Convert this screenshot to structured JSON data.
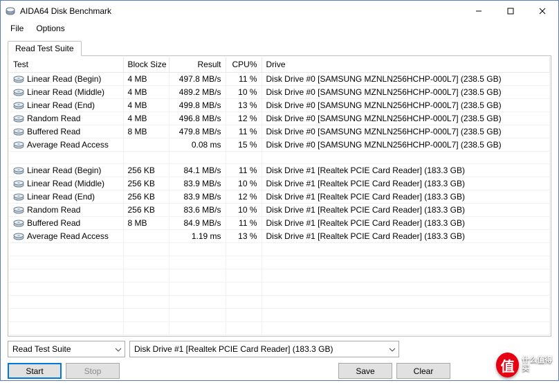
{
  "window": {
    "title": "AIDA64 Disk Benchmark"
  },
  "menu": {
    "file": "File",
    "options": "Options"
  },
  "tab": {
    "read_test_suite": "Read Test Suite"
  },
  "headers": {
    "test": "Test",
    "block_size": "Block Size",
    "result": "Result",
    "cpu": "CPU%",
    "drive": "Drive"
  },
  "rows": [
    {
      "test": "Linear Read (Begin)",
      "bs": "4 MB",
      "res": "497.8 MB/s",
      "cpu": "11 %",
      "drive": "Disk Drive #0  [SAMSUNG MZNLN256HCHP-000L7]  (238.5 GB)"
    },
    {
      "test": "Linear Read (Middle)",
      "bs": "4 MB",
      "res": "489.2 MB/s",
      "cpu": "10 %",
      "drive": "Disk Drive #0  [SAMSUNG MZNLN256HCHP-000L7]  (238.5 GB)"
    },
    {
      "test": "Linear Read (End)",
      "bs": "4 MB",
      "res": "499.8 MB/s",
      "cpu": "13 %",
      "drive": "Disk Drive #0  [SAMSUNG MZNLN256HCHP-000L7]  (238.5 GB)"
    },
    {
      "test": "Random Read",
      "bs": "4 MB",
      "res": "496.8 MB/s",
      "cpu": "12 %",
      "drive": "Disk Drive #0  [SAMSUNG MZNLN256HCHP-000L7]  (238.5 GB)"
    },
    {
      "test": "Buffered Read",
      "bs": "8 MB",
      "res": "479.8 MB/s",
      "cpu": "11 %",
      "drive": "Disk Drive #0  [SAMSUNG MZNLN256HCHP-000L7]  (238.5 GB)"
    },
    {
      "test": "Average Read Access",
      "bs": "",
      "res": "0.08 ms",
      "cpu": "15 %",
      "drive": "Disk Drive #0  [SAMSUNG MZNLN256HCHP-000L7]  (238.5 GB)"
    },
    {
      "spacer": true
    },
    {
      "test": "Linear Read (Begin)",
      "bs": "256 KB",
      "res": "84.1 MB/s",
      "cpu": "11 %",
      "drive": "Disk Drive #1  [Realtek PCIE Card Reader]  (183.3 GB)"
    },
    {
      "test": "Linear Read (Middle)",
      "bs": "256 KB",
      "res": "83.9 MB/s",
      "cpu": "10 %",
      "drive": "Disk Drive #1  [Realtek PCIE Card Reader]  (183.3 GB)"
    },
    {
      "test": "Linear Read (End)",
      "bs": "256 KB",
      "res": "83.9 MB/s",
      "cpu": "12 %",
      "drive": "Disk Drive #1  [Realtek PCIE Card Reader]  (183.3 GB)"
    },
    {
      "test": "Random Read",
      "bs": "256 KB",
      "res": "83.6 MB/s",
      "cpu": "10 %",
      "drive": "Disk Drive #1  [Realtek PCIE Card Reader]  (183.3 GB)"
    },
    {
      "test": "Buffered Read",
      "bs": "8 MB",
      "res": "84.9 MB/s",
      "cpu": "11 %",
      "drive": "Disk Drive #1  [Realtek PCIE Card Reader]  (183.3 GB)"
    },
    {
      "test": "Average Read Access",
      "bs": "",
      "res": "1.19 ms",
      "cpu": "13 %",
      "drive": "Disk Drive #1  [Realtek PCIE Card Reader]  (183.3 GB)"
    }
  ],
  "blank_rows": 7,
  "combos": {
    "suite": "Read Test Suite",
    "drive": "Disk Drive #1  [Realtek PCIE Card Reader]  (183.3 GB)"
  },
  "buttons": {
    "start": "Start",
    "stop": "Stop",
    "save": "Save",
    "clear": "Clear"
  },
  "watermark": {
    "badge": "值",
    "text": "什么值得买"
  }
}
